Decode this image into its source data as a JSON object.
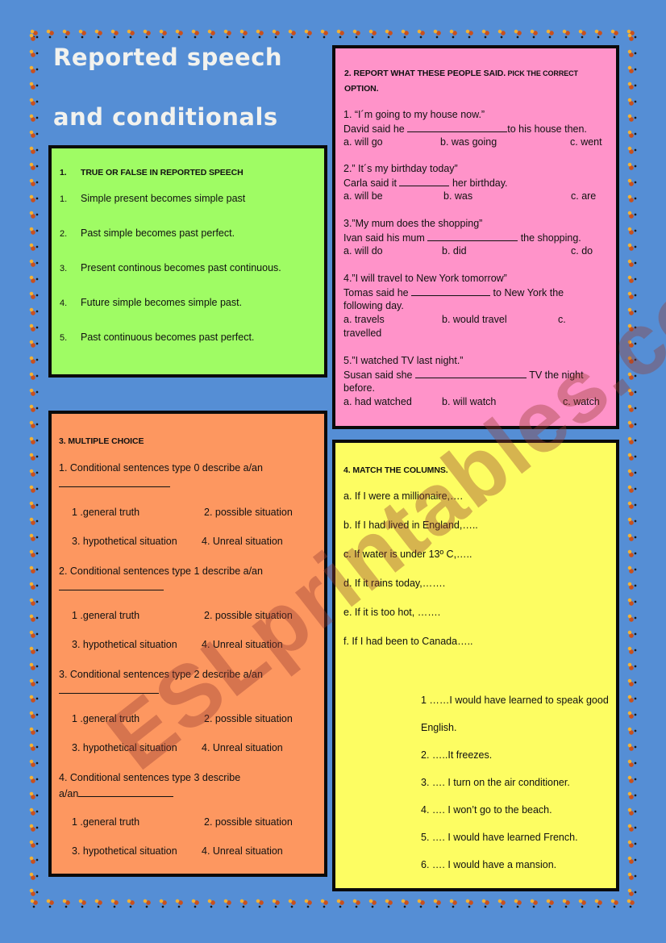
{
  "title": {
    "line1": "Reported speech",
    "line2": "and conditionals"
  },
  "section1": {
    "number": "1.",
    "heading": "TRUE OR FALSE IN REPORTED SPEECH",
    "items": [
      {
        "num": "1.",
        "text": "Simple present becomes simple past"
      },
      {
        "num": "2.",
        "text": "Past simple becomes past perfect."
      },
      {
        "num": "3.",
        "text": "Present continous becomes past continuous."
      },
      {
        "num": "4.",
        "text": "Future simple becomes simple past."
      },
      {
        "num": "5.",
        "text": "Past continuous  becomes past perfect."
      }
    ]
  },
  "section2": {
    "heading_main": "2.  REPORT WHAT THESE PEOPLE SAID.",
    "heading_small": " PICK THE CORRECT",
    "heading_line2": "OPTION.",
    "questions": [
      {
        "quote": "1.  “I´m going to my house now.”",
        "before": " David said he ",
        "after": "to his house then.",
        "a": "a. will go",
        "b": "b. was going",
        "c": "c. went"
      },
      {
        "quote": "2.” It´s my birthday today”",
        "before": "Carla said it ",
        "after": " her birthday.",
        "a": "a. will be",
        "b": "b. was",
        "c": "c. are"
      },
      {
        "quote": "3.”My mum does the shopping”",
        "before": "Ivan said his mum ",
        "after": " the shopping.",
        "a": "a. will do",
        "b": "b. did",
        "c": "c. do"
      },
      {
        "quote": "4.”I will travel to New York tomorrow”",
        "before": "Tomas said he ",
        "after": " to New York the",
        "cont": "following day.",
        "a": "a. travels",
        "b": "b. would travel",
        "c": "c.",
        "c_cont": "travelled"
      },
      {
        "quote": "5.”I watched TV last night.”",
        "before": "Susan said she ",
        "after": " TV the night",
        "cont": "before.",
        "a": "a. had watched",
        "b": "b. will watch",
        "c": "c. watch"
      }
    ]
  },
  "section3": {
    "heading": "3. MULTIPLE CHOICE",
    "questions": [
      {
        "stem": "1. Conditional sentences type 0 describe a/an"
      },
      {
        "stem": "2. Conditional sentences type 1 describe a/an"
      },
      {
        "stem": "3. Conditional sentences type 2 describe a/an"
      },
      {
        "stem": "4. Conditional sentences type 3 describe",
        "stem2": "a/an"
      }
    ],
    "options": {
      "o1": "1 .general truth",
      "o2": "2. possible situation",
      "o3": "3. hypothetical situation",
      "o4": "4. Unreal situation"
    }
  },
  "section4": {
    "heading": "4. MATCH THE COLUMNS.",
    "left": [
      "a. If I were a millionaire,….",
      "b. If I had lived in England,…..",
      "c. If water is  under 13º C,…..",
      "d. If it rains today,…….",
      "e. If it is too hot, …….",
      "f. If I had been to Canada….."
    ],
    "right": [
      "1 ……I would have learned to speak good",
      "English.",
      "2. …..It freezes.",
      "3. …. I turn on the air conditioner.",
      "4. …. I won’t go to the beach.",
      "5. …. I would have learned French.",
      "6. …. I would have a mansion."
    ]
  },
  "watermark": "ESLprintables.com"
}
